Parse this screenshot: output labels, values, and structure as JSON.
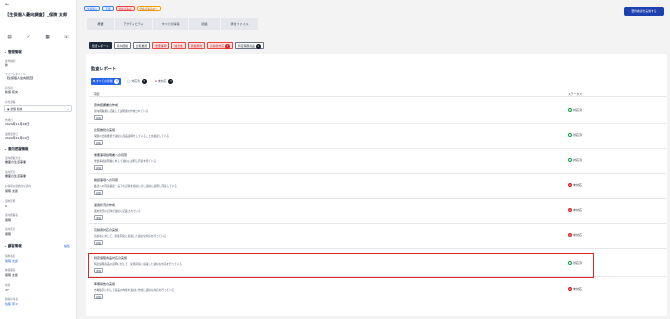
{
  "header": {
    "back_icon": "arrow-left-icon",
    "title": "【生保個人最向調査】_保険 太郎",
    "tags": [
      {
        "label": "生保個人",
        "style": "blue"
      },
      {
        "label": "不備",
        "style": "blue"
      },
      {
        "label": "要確認事項",
        "style": "red"
      },
      {
        "label": "要確認事項あり",
        "style": "orange"
      }
    ],
    "action_button": "要件確認を実施する"
  },
  "left_icons": [
    "chat-icon",
    "check-icon",
    "calendar-icon",
    "phone-icon"
  ],
  "left": {
    "management_section": "管理情報",
    "fields": [
      {
        "label": "案件種別",
        "value": "新"
      },
      {
        "label": "フォームタイトル",
        "value": "【生保個人最向調査】"
      },
      {
        "label": "担当者",
        "value": "新保 和央"
      },
      {
        "label": "担当部署",
        "value": ""
      },
      {
        "label": "作成日",
        "value": "2024年11月28日"
      },
      {
        "label": "最終更新日",
        "value": "2024年12月01日"
      }
    ],
    "select_value": "新保 和央",
    "proposal_section": "意向把握情報",
    "proposal_fields": [
      {
        "label": "意向把握方法",
        "value": "書面の生活事業"
      },
      {
        "label": "意向区分",
        "value": "書面の生活事業"
      },
      {
        "label": "お客様の最終的な意向",
        "value": "保険 太郎"
      },
      {
        "label": "契約形態",
        "value": "0"
      },
      {
        "label": "意向把握者",
        "value": "保険"
      },
      {
        "label": "意向区分",
        "value": "保険"
      }
    ],
    "customer_section": "顧客情報",
    "customer_edit": "編集",
    "customer_fields": [
      {
        "label": "契約者名",
        "value": "保険 太郎",
        "link": true
      },
      {
        "label": "被保険者",
        "value": "保険 太郎",
        "link": false
      },
      {
        "label": "年齢",
        "value": "37",
        "link": false
      },
      {
        "label": "顧客担当者",
        "value": "佐藤 奈々",
        "link": true
      }
    ]
  },
  "top_tabs": [
    "概要",
    "アクティビティ",
    "すべての情報",
    "関連",
    "添付ファイル"
  ],
  "sub_tabs": [
    {
      "label": "監査レポート",
      "style": "active",
      "badge": ""
    },
    {
      "label": "意向把握",
      "style": "normal",
      "badge": ""
    },
    {
      "label": "比較推奨",
      "style": "normal",
      "badge": ""
    },
    {
      "label": "重要事項",
      "style": "red",
      "badge": ""
    },
    {
      "label": "適合性",
      "style": "red",
      "badge": ""
    },
    {
      "label": "募集規則",
      "style": "red",
      "badge": ""
    },
    {
      "label": "高齢者対応",
      "style": "red",
      "badge": "1"
    },
    {
      "label": "特定保険商品",
      "style": "normal",
      "badge": "1"
    }
  ],
  "report": {
    "title": "監査レポート",
    "filters": [
      {
        "label": "すべての評価",
        "count": "8",
        "active": true,
        "icon": "filter-icon"
      },
      {
        "label": "対応済",
        "count": "5",
        "active": false,
        "icon": "check-circle-icon"
      },
      {
        "label": "未対応",
        "count": "3",
        "active": false,
        "icon": "x-circle-icon"
      }
    ],
    "col_item": "項目",
    "col_status": "ステータス",
    "rows": [
      {
        "title": "意向把握書の作成",
        "desc": "意向把握書に記載して説明書の作成されている",
        "chip": "詳細",
        "status": "対応済",
        "ok": true
      },
      {
        "title": "比較推奨の実施",
        "desc": "保険の比較推奨で適切に商品説明をしていることを確認している",
        "chip": "詳細",
        "status": "対応済",
        "ok": true
      },
      {
        "title": "重要事項説明書への同意",
        "desc": "重要事項説明書に対して適切に説明し同意を得ている",
        "chip": "詳細",
        "status": "対応済",
        "ok": true
      },
      {
        "title": "確認事項への同意",
        "desc": "確認への同意確認・完了の記録を適切に示し適切に説明し同意している",
        "chip": "詳細",
        "status": "未対応",
        "ok": false
      },
      {
        "title": "運用状況の作成",
        "desc": "運用状況の記録が適切に記載されている",
        "chip": "詳細",
        "status": "未対応",
        "ok": false
      },
      {
        "title": "高齢者対応の実施",
        "desc": "高齢者に対して、家族同席に意識した適切な対応を行っている",
        "chip": "詳細",
        "status": "未対応",
        "ok": false
      },
      {
        "title": "特定保険商品対応の実施",
        "desc": "特定保険商品の説明に対して、家族同席に意識した適切な対応を行っている",
        "chip": "詳細",
        "status": "対応済",
        "ok": true
      },
      {
        "title": "準備報告の実施",
        "desc": "市場取引に対して商品の内容を適切に作成し適切な対応を行っている",
        "chip": "詳細",
        "status": "未対応",
        "ok": false
      }
    ]
  }
}
